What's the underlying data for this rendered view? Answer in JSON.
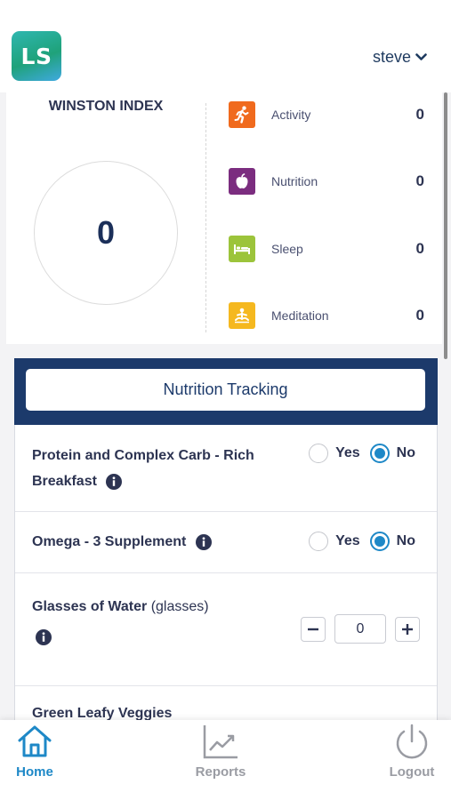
{
  "header": {
    "logo_text": "LS",
    "username": "steve"
  },
  "index": {
    "title": "WINSTON INDEX",
    "score": "0",
    "metrics": [
      {
        "label": "Activity",
        "value": "0",
        "color": "#f06a1d",
        "icon": "running-icon"
      },
      {
        "label": "Nutrition",
        "value": "0",
        "color": "#7b2d7f",
        "icon": "apple-icon"
      },
      {
        "label": "Sleep",
        "value": "0",
        "color": "#9cc43b",
        "icon": "bed-icon"
      },
      {
        "label": "Meditation",
        "value": "0",
        "color": "#f5b81f",
        "icon": "meditation-icon"
      }
    ]
  },
  "tracking": {
    "title": "Nutrition Tracking",
    "header_color": "#1c3a6b",
    "items": [
      {
        "label_line1": "Protein and Complex Carb - Rich",
        "label_line2": "Breakfast",
        "yes": "Yes",
        "no": "No",
        "selected": "No"
      },
      {
        "label_line1": "Omega - 3 Supplement",
        "yes": "Yes",
        "no": "No",
        "selected": "No"
      },
      {
        "label": "Glasses of Water",
        "unit": "(glasses)",
        "value": "0",
        "minus": "−",
        "plus": "+"
      },
      {
        "label": "Green Leafy Veggies"
      }
    ]
  },
  "nav": {
    "active_color": "#1e88c7",
    "inactive_color": "#9a9ca3",
    "items": [
      {
        "label": "Home",
        "icon": "home-icon",
        "active": true
      },
      {
        "label": "Reports",
        "icon": "chart-icon",
        "active": false
      },
      {
        "label": "Logout",
        "icon": "power-icon",
        "active": false
      }
    ]
  }
}
